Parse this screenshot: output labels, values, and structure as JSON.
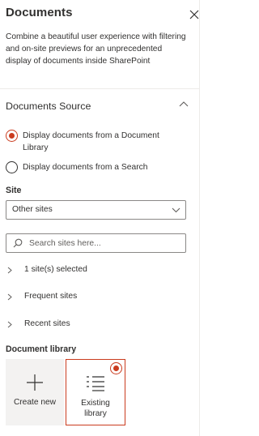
{
  "panel": {
    "title": "Documents",
    "description": "Combine a beautiful user experience with filtering and on-site previews for an unprecedented display of documents inside SharePoint"
  },
  "documents_source": {
    "title": "Documents Source",
    "options": [
      {
        "label": "Display documents from a Document Library",
        "checked": true
      },
      {
        "label": "Display documents from a Search",
        "checked": false
      }
    ]
  },
  "site": {
    "label": "Site",
    "selected_value": "Other sites"
  },
  "search": {
    "placeholder": "Search sites here..."
  },
  "expanders": [
    {
      "label": "1 site(s) selected"
    },
    {
      "label": "Frequent sites"
    },
    {
      "label": "Recent sites"
    }
  ],
  "document_library": {
    "label": "Document library",
    "tiles": [
      {
        "label": "Create new",
        "icon": "plus-icon",
        "selected": false
      },
      {
        "label": "Existing library",
        "icon": "list-icon",
        "selected": true
      }
    ]
  },
  "colors": {
    "accent": "#ca3b1e",
    "text": "#323130",
    "border": "#8a8886",
    "divider": "#edebe9",
    "tile_bg": "#f3f2f1"
  }
}
